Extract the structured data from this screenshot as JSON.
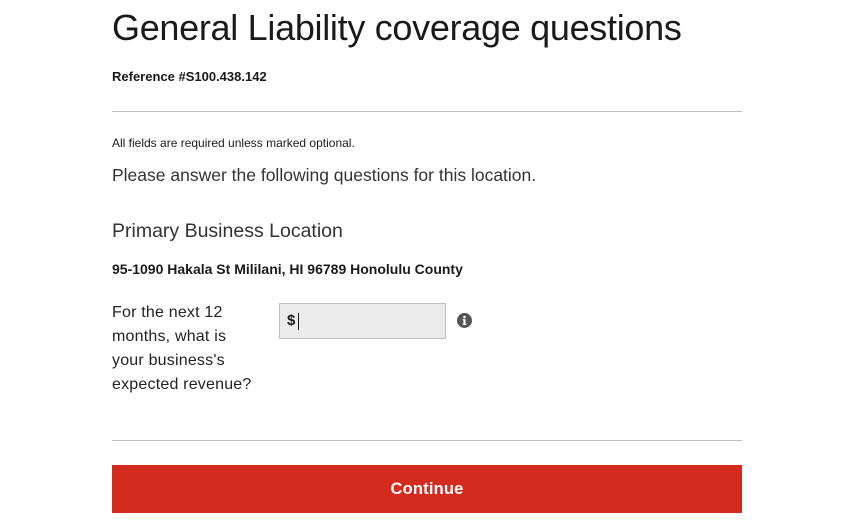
{
  "page": {
    "title": "General Liability coverage questions",
    "reference": "Reference #S100.438.142",
    "required_note": "All fields are required unless marked optional.",
    "instructions": "Please answer the following questions for this location."
  },
  "location": {
    "heading": "Primary Business Location",
    "address": "95-1090 Hakala St Mililani, HI 96789 Honolulu County"
  },
  "revenue_question": {
    "label": "For the next 12 months, what is your business's expected revenue?",
    "currency_symbol": "$",
    "value": "",
    "info_icon": "info-circle-icon"
  },
  "actions": {
    "continue_label": "Continue"
  },
  "colors": {
    "primary_button": "#d52b1e",
    "input_background": "#ebebeb",
    "divider": "#bdbdbd"
  }
}
